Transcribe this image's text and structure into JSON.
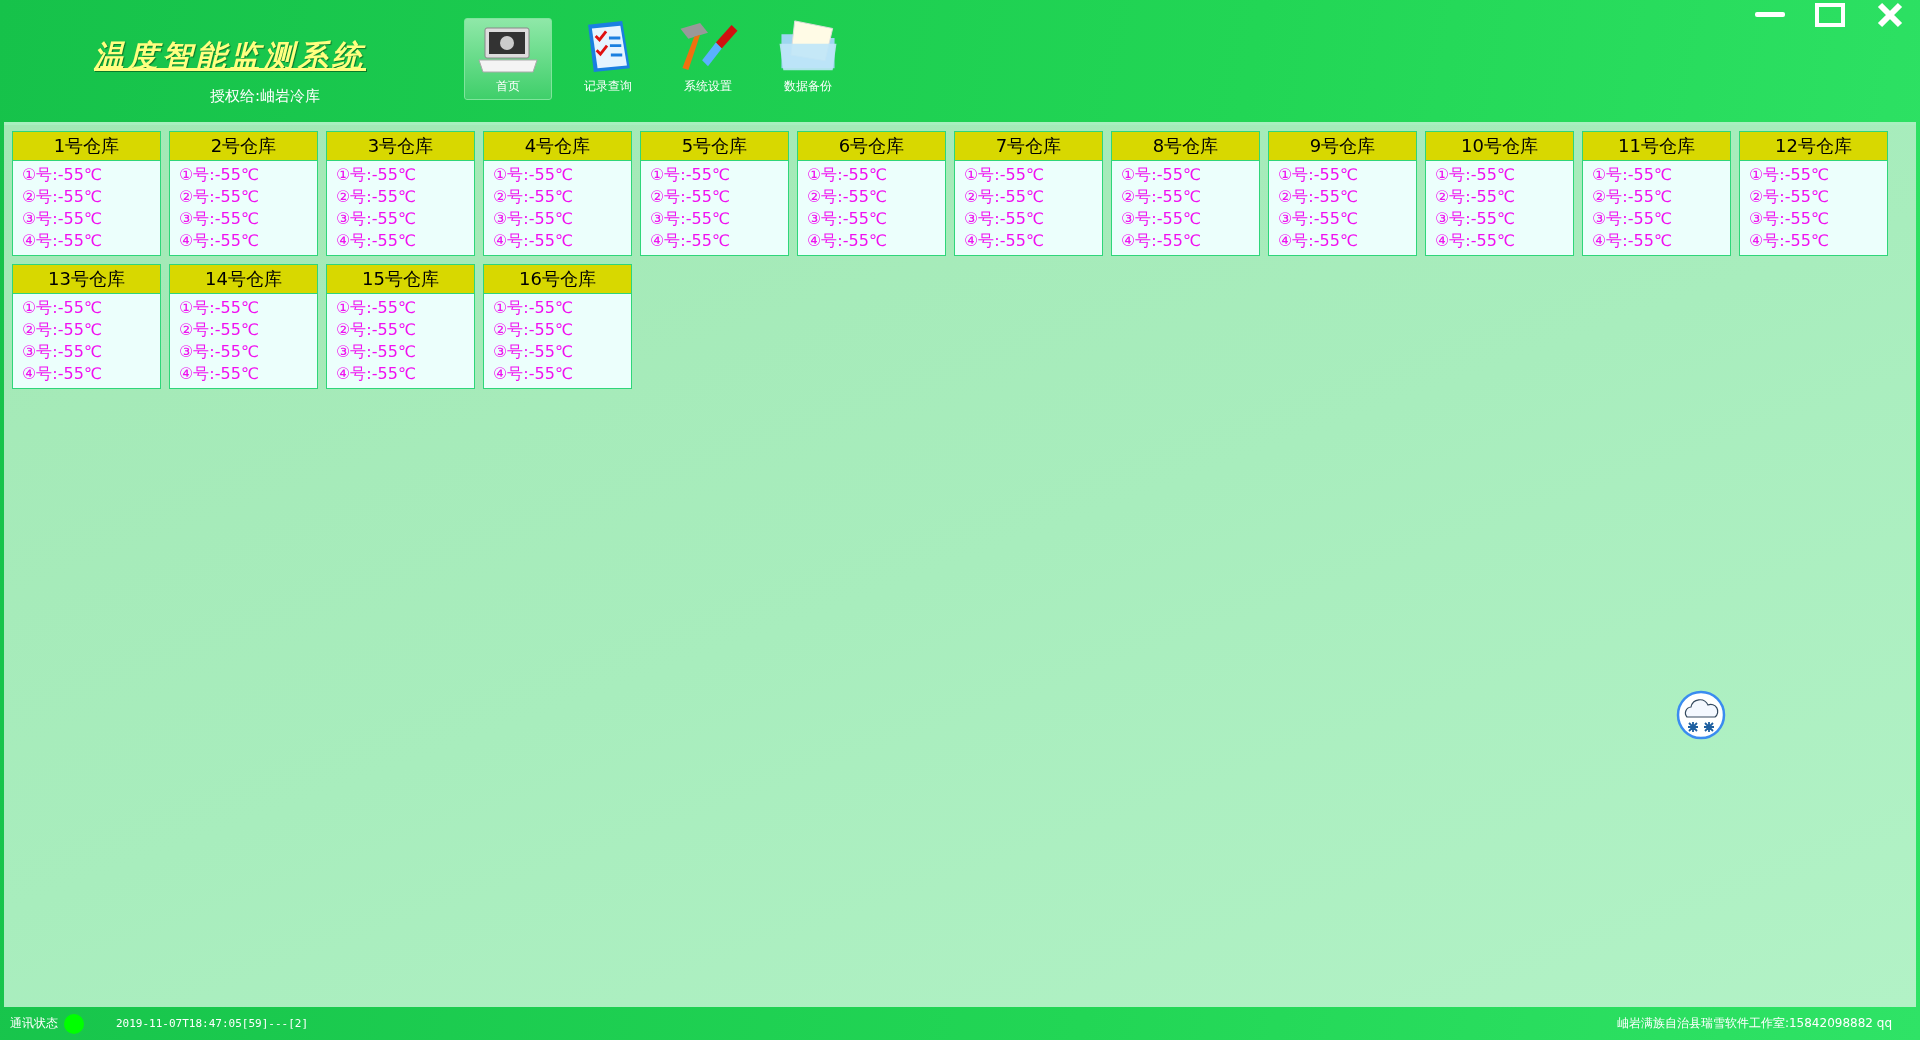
{
  "header": {
    "title": "温度智能监测系统",
    "license": "授权给:岫岩冷库"
  },
  "toolbar": [
    {
      "label": "首页",
      "kind": "monitor",
      "selected": true
    },
    {
      "label": "记录查询",
      "kind": "checklist",
      "selected": false
    },
    {
      "label": "系统设置",
      "kind": "tools",
      "selected": false
    },
    {
      "label": "数据备份",
      "kind": "folder",
      "selected": false
    }
  ],
  "warehouses": [
    {
      "name": "1号仓库",
      "sensors": [
        "①号:-55℃",
        "②号:-55℃",
        "③号:-55℃",
        "④号:-55℃"
      ]
    },
    {
      "name": "2号仓库",
      "sensors": [
        "①号:-55℃",
        "②号:-55℃",
        "③号:-55℃",
        "④号:-55℃"
      ]
    },
    {
      "name": "3号仓库",
      "sensors": [
        "①号:-55℃",
        "②号:-55℃",
        "③号:-55℃",
        "④号:-55℃"
      ]
    },
    {
      "name": "4号仓库",
      "sensors": [
        "①号:-55℃",
        "②号:-55℃",
        "③号:-55℃",
        "④号:-55℃"
      ]
    },
    {
      "name": "5号仓库",
      "sensors": [
        "①号:-55℃",
        "②号:-55℃",
        "③号:-55℃",
        "④号:-55℃"
      ]
    },
    {
      "name": "6号仓库",
      "sensors": [
        "①号:-55℃",
        "②号:-55℃",
        "③号:-55℃",
        "④号:-55℃"
      ]
    },
    {
      "name": "7号仓库",
      "sensors": [
        "①号:-55℃",
        "②号:-55℃",
        "③号:-55℃",
        "④号:-55℃"
      ]
    },
    {
      "name": "8号仓库",
      "sensors": [
        "①号:-55℃",
        "②号:-55℃",
        "③号:-55℃",
        "④号:-55℃"
      ]
    },
    {
      "name": "9号仓库",
      "sensors": [
        "①号:-55℃",
        "②号:-55℃",
        "③号:-55℃",
        "④号:-55℃"
      ]
    },
    {
      "name": "10号仓库",
      "sensors": [
        "①号:-55℃",
        "②号:-55℃",
        "③号:-55℃",
        "④号:-55℃"
      ]
    },
    {
      "name": "11号仓库",
      "sensors": [
        "①号:-55℃",
        "②号:-55℃",
        "③号:-55℃",
        "④号:-55℃"
      ]
    },
    {
      "name": "12号仓库",
      "sensors": [
        "①号:-55℃",
        "②号:-55℃",
        "③号:-55℃",
        "④号:-55℃"
      ]
    },
    {
      "name": "13号仓库",
      "sensors": [
        "①号:-55℃",
        "②号:-55℃",
        "③号:-55℃",
        "④号:-55℃"
      ]
    },
    {
      "name": "14号仓库",
      "sensors": [
        "①号:-55℃",
        "②号:-55℃",
        "③号:-55℃",
        "④号:-55℃"
      ]
    },
    {
      "name": "15号仓库",
      "sensors": [
        "①号:-55℃",
        "②号:-55℃",
        "③号:-55℃",
        "④号:-55℃"
      ]
    },
    {
      "name": "16号仓库",
      "sensors": [
        "①号:-55℃",
        "②号:-55℃",
        "③号:-55℃",
        "④号:-55℃"
      ]
    }
  ],
  "status_bar": {
    "comm_label": "通讯状态",
    "comm_on": true,
    "timestamp": "2019-11-07T18:47:05[59]---[2]",
    "contact": "岫岩满族自治县瑞雪软件工作室:15842098882 qq"
  }
}
